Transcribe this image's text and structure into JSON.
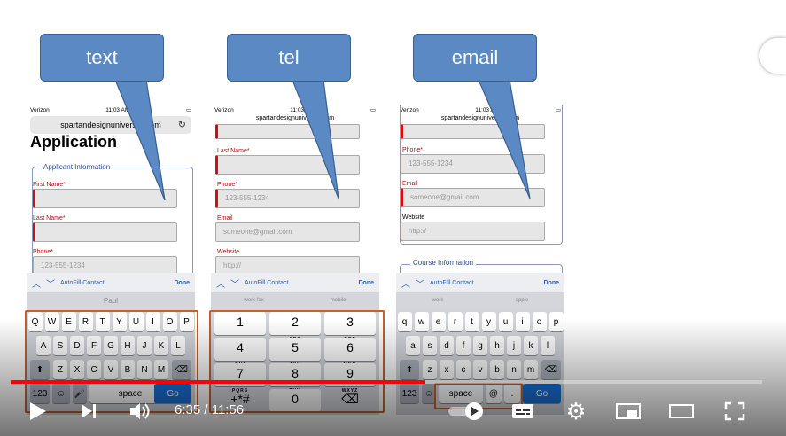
{
  "callouts": [
    {
      "label": "text"
    },
    {
      "label": "tel"
    },
    {
      "label": "email"
    }
  ],
  "status": {
    "carrier": "Verizon",
    "time": "11:03 AM"
  },
  "phone1": {
    "url": "spartandesignuniversity.com",
    "title": "Application",
    "legend": "Applicant Information",
    "labels": {
      "first": "First Name",
      "last": "Last Name",
      "phone": "Phone"
    },
    "placeholders": {
      "phone": "123-555-1234"
    },
    "toolbar": {
      "autofill": "AutoFill Contact",
      "done": "Done"
    },
    "suggestion": "Paul",
    "rows": [
      [
        "Q",
        "W",
        "E",
        "R",
        "T",
        "Y",
        "U",
        "I",
        "O",
        "P"
      ],
      [
        "A",
        "S",
        "D",
        "F",
        "G",
        "H",
        "J",
        "K",
        "L"
      ],
      [
        "Z",
        "X",
        "C",
        "V",
        "B",
        "N",
        "M"
      ]
    ],
    "bottom": {
      "numkey": "123",
      "space": "space",
      "go": "Go"
    }
  },
  "phone2": {
    "url": "spartandesignuniversity.com",
    "labels": {
      "last": "Last Name",
      "phone": "Phone",
      "email": "Email",
      "website": "Website"
    },
    "placeholders": {
      "phone": "123-555-1234",
      "email": "someone@gmail.com",
      "website": "http://"
    },
    "toolbar": {
      "autofill": "AutoFill Contact",
      "done": "Done"
    },
    "suggestions": [
      "work fax",
      "mobile"
    ],
    "numpad": [
      {
        "n": "1",
        "s": ""
      },
      {
        "n": "2",
        "s": "ABC"
      },
      {
        "n": "3",
        "s": "DEF"
      },
      {
        "n": "4",
        "s": "GHI"
      },
      {
        "n": "5",
        "s": "JKL"
      },
      {
        "n": "6",
        "s": "MNO"
      },
      {
        "n": "7",
        "s": "PQRS"
      },
      {
        "n": "8",
        "s": "TUV"
      },
      {
        "n": "9",
        "s": "WXYZ"
      },
      {
        "n": "+*#",
        "s": ""
      },
      {
        "n": "0",
        "s": ""
      },
      {
        "n": "⌫",
        "s": ""
      }
    ]
  },
  "phone3": {
    "url": "spartandesignuniversity.com",
    "labels": {
      "phone": "Phone",
      "email": "Email",
      "website": "Website",
      "course": "Course Information"
    },
    "placeholders": {
      "phone": "123-555-1234",
      "email": "someone@gmail.com",
      "website": "http://"
    },
    "toolbar": {
      "autofill": "AutoFill Contact",
      "done": "Done"
    },
    "suggestions": [
      "work",
      "apple"
    ],
    "rows": [
      [
        "q",
        "w",
        "e",
        "r",
        "t",
        "y",
        "u",
        "i",
        "o",
        "p"
      ],
      [
        "a",
        "s",
        "d",
        "f",
        "g",
        "h",
        "j",
        "k",
        "l"
      ],
      [
        "z",
        "x",
        "c",
        "v",
        "b",
        "n",
        "m"
      ]
    ],
    "bottom": {
      "numkey": "123",
      "space": "space",
      "at": "@",
      "dot": ".",
      "go": "Go"
    }
  },
  "player": {
    "current_time": "6:35",
    "separator": "/",
    "duration": "11:56",
    "progress": 0.552
  },
  "colors": {
    "accent": "#ff0000",
    "callout": "#5b89c4",
    "highlight": "#c8602a"
  }
}
